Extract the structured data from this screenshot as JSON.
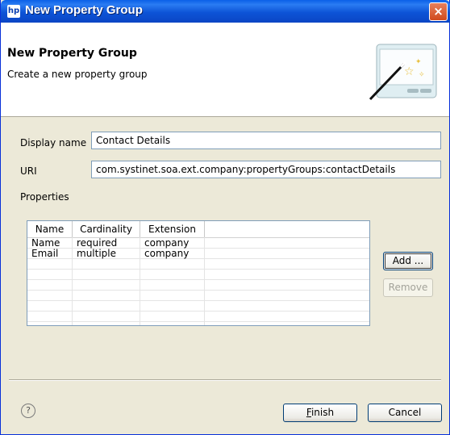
{
  "window": {
    "title": "New Property Group",
    "logo": "hp-logo",
    "close": "×"
  },
  "banner": {
    "title": "New Property Group",
    "description": "Create a new property group",
    "image": "wizard-wand-icon"
  },
  "form": {
    "display_name_label": "Display name",
    "display_name_value": "Contact Details",
    "uri_label": "URI",
    "uri_value": "com.systinet.soa.ext.company:propertyGroups:contactDetails",
    "properties_label": "Properties"
  },
  "table": {
    "columns": [
      "Name",
      "Cardinality",
      "Extension"
    ],
    "rows": [
      [
        "Name",
        "required",
        "company"
      ],
      [
        "Email",
        "multiple",
        "company"
      ]
    ]
  },
  "buttons": {
    "add": "Add ...",
    "remove": "Remove",
    "finish_rest": "inish",
    "finish_mnemonic": "F",
    "cancel": "Cancel"
  },
  "help": {
    "glyph": "?"
  }
}
